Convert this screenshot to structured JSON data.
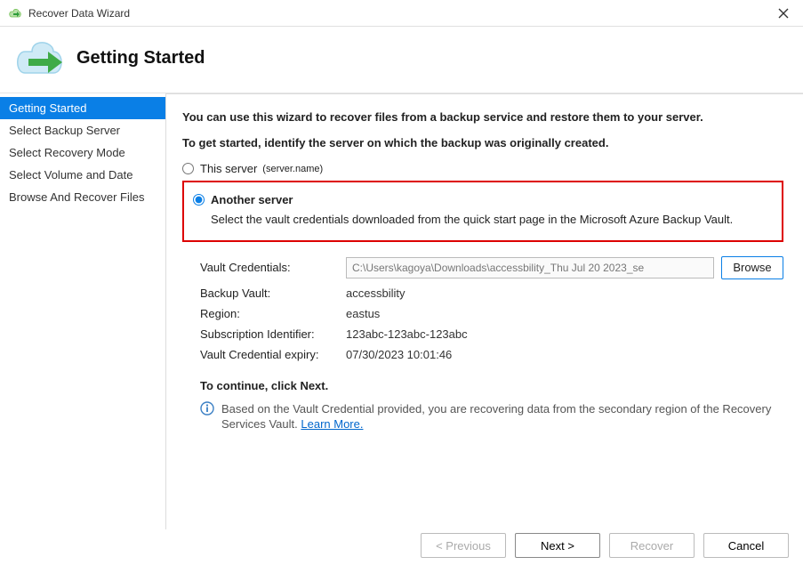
{
  "window": {
    "title": "Recover Data Wizard"
  },
  "header": {
    "title": "Getting Started"
  },
  "sidebar": {
    "steps": [
      "Getting Started",
      "Select Backup Server",
      "Select Recovery Mode",
      "Select Volume and Date",
      "Browse And Recover Files"
    ]
  },
  "content": {
    "intro": "You can use this wizard to recover files from a backup service and restore them to your server.",
    "identify": "To get started, identify the server on which the backup was originally created.",
    "this_server_label": "This server",
    "this_server_paren": "(server.name)",
    "another_server_label": "Another server",
    "another_server_desc": "Select the vault credentials downloaded from the quick start page in the Microsoft Azure Backup Vault.",
    "vault_credentials_label": "Vault Credentials:",
    "vault_credentials_value": "C:\\Users\\kagoya\\Downloads\\accessbility_Thu Jul 20 2023_se",
    "browse_label": "Browse",
    "backup_vault_label": "Backup Vault:",
    "backup_vault_value": "accessbility",
    "region_label": "Region:",
    "region_value": "eastus",
    "subscription_label": "Subscription Identifier:",
    "subscription_value": "123abc-123abc-123abc",
    "expiry_label": "Vault Credential expiry:",
    "expiry_value": "07/30/2023 10:01:46",
    "continue_text": "To continue, click Next.",
    "info_text": "Based on the Vault Credential provided, you are recovering data from the secondary region of the Recovery Services Vault.",
    "learn_more": " Learn More."
  },
  "footer": {
    "previous": "< Previous",
    "next": "Next >",
    "recover": "Recover",
    "cancel": "Cancel"
  }
}
